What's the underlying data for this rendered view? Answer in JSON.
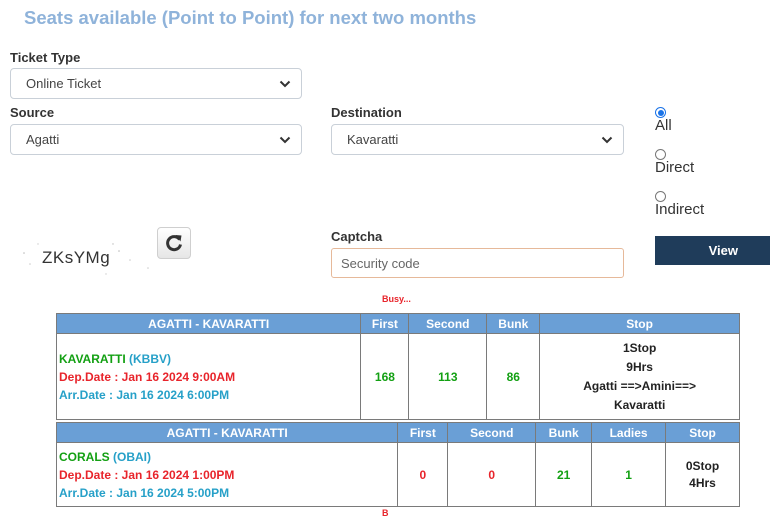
{
  "page_title": "Seats available (Point to Point) for next two months",
  "ticket_type": {
    "label": "Ticket Type",
    "value": "Online Ticket"
  },
  "source": {
    "label": "Source",
    "value": "Agatti"
  },
  "destination": {
    "label": "Destination",
    "value": "Kavaratti"
  },
  "route_filter": {
    "selected": "All",
    "options": [
      {
        "label": "All",
        "checked": true
      },
      {
        "label": "Direct",
        "checked": false
      },
      {
        "label": "Indirect",
        "checked": false
      }
    ]
  },
  "captcha": {
    "label": "Captcha",
    "image_text": "ZKsYMg",
    "placeholder": "Security code"
  },
  "view_button": "View",
  "busy_text": "Busy...",
  "busy_text_2": "B",
  "table1": {
    "headers": [
      "AGATTI - KAVARATTI",
      "First",
      "Second",
      "Bunk",
      "Stop"
    ],
    "ship_name": "KAVARATTI",
    "ship_code": "(KBBV)",
    "dep": "Dep.Date : Jan 16 2024 9:00AM",
    "arr": "Arr.Date : Jan 16 2024 6:00PM",
    "first": "168",
    "second": "113",
    "bunk": "86",
    "stop_lines": [
      "1Stop",
      "9Hrs",
      "Agatti ==>Amini==>",
      "Kavaratti"
    ]
  },
  "table2": {
    "headers": [
      "AGATTI - KAVARATTI",
      "First",
      "Second",
      "Bunk",
      "Ladies",
      "Stop"
    ],
    "ship_name": "CORALS",
    "ship_code": "(OBAI)",
    "dep": "Dep.Date : Jan 16 2024 1:00PM",
    "arr": "Arr.Date : Jan 16 2024 5:00PM",
    "first": "0",
    "second": "0",
    "bunk": "21",
    "ladies": "1",
    "stop_lines": [
      "0Stop",
      "4Hrs"
    ]
  },
  "colors": {
    "header_blue": "#6a9fd6",
    "view_button_bg": "#1f3c5a",
    "title_color": "#8fb3da",
    "green": "#13a013",
    "red": "#e8242b",
    "cyan": "#26a0c8"
  }
}
